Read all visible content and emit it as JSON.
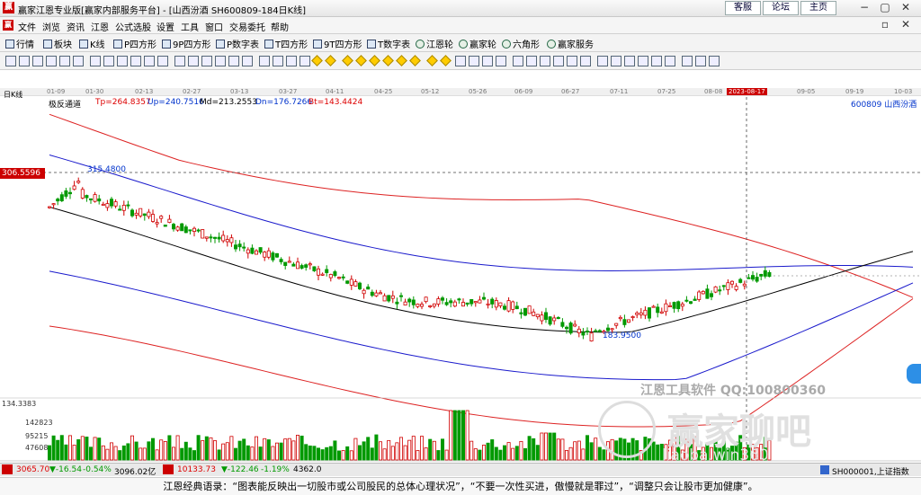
{
  "titlebar": {
    "title": "赢家江恩专业版[赢家内部服务平台] - [山西汾酒  SH600809-184日K线]",
    "buttons": [
      "客服",
      "论坛",
      "主页"
    ],
    "window_controls": [
      "−",
      "▢",
      "✕"
    ]
  },
  "menu": [
    "文件",
    "浏览",
    "资讯",
    "江恩",
    "公式选股",
    "设置",
    "工具",
    "窗口",
    "交易委托",
    "帮助"
  ],
  "toolbar1": [
    "行情",
    "板块",
    "K线",
    "P四方形",
    "9P四方形",
    "P数字表",
    "T四方形",
    "9T四方形",
    "T数字表",
    "江恩轮",
    "赢家轮",
    "六角形",
    "赢家服务"
  ],
  "dates": [
    "01-09",
    "01-30",
    "02-13",
    "02-27",
    "03-13",
    "03-27",
    "04-11",
    "04-25",
    "05-12",
    "05-26",
    "06-09",
    "06-27",
    "07-11",
    "07-25",
    "08-08",
    "2023-08-17",
    "09-05",
    "09-19",
    "10-03"
  ],
  "period_label": "日K线",
  "indicator": {
    "name": "极反通道",
    "tp": "Tp=264.8357",
    "up": "Up=240.7516",
    "md": "Md=213.2553",
    "dn": "Dn=176.7266",
    "bt": "Bt=143.4424"
  },
  "stock": "600809  山西汾酒",
  "price_flag": "306.5596",
  "high_label": "315.4800",
  "low_label": "183.9500",
  "volume_ticks": [
    "134.3383",
    "142823",
    "95215",
    "47608"
  ],
  "watermark": {
    "line1": "江恩工具软件  QQ:100800360",
    "line2": "赢家聊吧",
    "line3": "liaoba.win360"
  },
  "status": {
    "sh": "3065.70",
    "sh_chg": "▼-16.54",
    "sh_pct": "-0.54%",
    "sh_amt": "3096.02亿",
    "sz": "10133.73",
    "sz_chg": "▼-122.46",
    "sz_pct": "-1.19%",
    "sz_amt": "4362.0",
    "right": "SH000001,上证指数"
  },
  "quote": "江恩经典语录：“图表能反映出一切股市或公司股民的总体心理状况”，“不要一次性买进，傲慢就是罪过”，“调整只会让股市更加健康”。",
  "colors": {
    "up": "#d00000",
    "down": "#009900",
    "mid": "#000000",
    "inner": "#1a1acc",
    "outer": "#dd2222"
  }
}
